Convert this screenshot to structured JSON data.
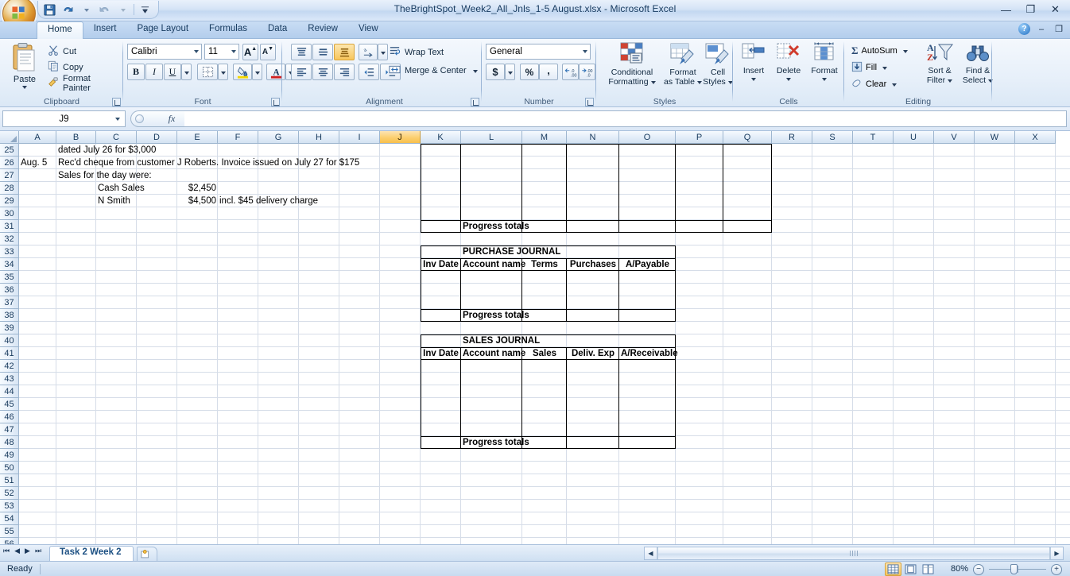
{
  "window": {
    "title": "TheBrightSpot_Week2_All_Jnls_1-5 August.xlsx  -  Microsoft Excel",
    "minimize": "—",
    "restore": "❐",
    "close": "✕"
  },
  "quick_access": {
    "save": "save-icon",
    "undo": "undo-icon",
    "redo": "redo-icon",
    "customize": "customize-icon"
  },
  "tabs": [
    {
      "label": "Home",
      "active": true
    },
    {
      "label": "Insert",
      "active": false
    },
    {
      "label": "Page Layout",
      "active": false
    },
    {
      "label": "Formulas",
      "active": false
    },
    {
      "label": "Data",
      "active": false
    },
    {
      "label": "Review",
      "active": false
    },
    {
      "label": "View",
      "active": false
    }
  ],
  "help": {
    "help_label": "?",
    "minimize_ribbon": "–",
    "restore_window": "❐"
  },
  "ribbon": {
    "clipboard": {
      "group_label": "Clipboard",
      "paste": "Paste",
      "cut": "Cut",
      "copy": "Copy",
      "format_painter": "Format Painter"
    },
    "font": {
      "group_label": "Font",
      "font_name": "Calibri",
      "font_size": "11",
      "grow_font": "A",
      "shrink_font": "A",
      "bold": "B",
      "italic": "I",
      "underline": "U",
      "borders": "borders-icon",
      "fill_color": "fill-color-icon",
      "font_color": "font-color-icon"
    },
    "alignment": {
      "group_label": "Alignment",
      "align_top": "align-top-icon",
      "align_middle": "align-middle-icon",
      "align_bottom": "align-bottom-icon",
      "orientation": "orientation-icon",
      "align_left": "align-left-icon",
      "align_center": "align-center-icon",
      "align_right": "align-right-icon",
      "decrease_indent": "decrease-indent-icon",
      "increase_indent": "increase-indent-icon",
      "wrap_text": "Wrap Text",
      "merge_center": "Merge & Center"
    },
    "number": {
      "group_label": "Number",
      "format": "General",
      "accounting": "$",
      "percent": "%",
      "comma": ",",
      "increase_decimal": "increase-decimal-icon",
      "decrease_decimal": "decrease-decimal-icon"
    },
    "styles": {
      "group_label": "Styles",
      "conditional_formatting": "Conditional\nFormatting",
      "conditional_formatting_l1": "Conditional",
      "conditional_formatting_l2": "Formatting",
      "format_as_table_l1": "Format",
      "format_as_table_l2": "as Table",
      "cell_styles_l1": "Cell",
      "cell_styles_l2": "Styles"
    },
    "cells": {
      "group_label": "Cells",
      "insert": "Insert",
      "delete": "Delete",
      "format": "Format"
    },
    "editing": {
      "group_label": "Editing",
      "autosum": "AutoSum",
      "fill": "Fill",
      "clear": "Clear",
      "sort_filter_l1": "Sort &",
      "sort_filter_l2": "Filter",
      "find_select_l1": "Find &",
      "find_select_l2": "Select"
    }
  },
  "formula_bar": {
    "name_box": "J9",
    "fx_label": "fx",
    "formula_value": "",
    "insert_function": "insert-function-icon"
  },
  "grid": {
    "columns": [
      "A",
      "B",
      "C",
      "D",
      "E",
      "F",
      "G",
      "H",
      "I",
      "J",
      "K",
      "L",
      "M",
      "N",
      "O",
      "P",
      "Q",
      "R",
      "S",
      "T",
      "U",
      "V",
      "W",
      "X"
    ],
    "selected_column": "J",
    "rows": [
      25,
      26,
      27,
      28,
      29,
      30,
      31,
      32,
      33,
      34,
      35,
      36,
      37,
      38,
      39,
      40,
      41,
      42,
      43,
      44,
      45,
      46,
      47,
      48,
      49,
      50,
      51,
      52,
      53,
      54,
      55,
      56
    ],
    "cells": [
      {
        "row": 25,
        "col": "B",
        "text": "dated July 26 for $3,000",
        "align": "left",
        "bold": false
      },
      {
        "row": 26,
        "col": "A",
        "text": "Aug. 5",
        "align": "left",
        "bold": false
      },
      {
        "row": 26,
        "col": "B",
        "text": "Rec'd cheque from customer J Roberts. Invoice issued on July 27 for $175",
        "align": "left",
        "bold": false
      },
      {
        "row": 27,
        "col": "B",
        "text": "Sales for the day were:",
        "align": "left",
        "bold": false
      },
      {
        "row": 28,
        "col": "C",
        "text": "Cash Sales",
        "align": "left",
        "bold": false
      },
      {
        "row": 28,
        "col": "E",
        "text": "$2,450",
        "align": "right",
        "bold": false
      },
      {
        "row": 29,
        "col": "C",
        "text": "N Smith",
        "align": "left",
        "bold": false
      },
      {
        "row": 29,
        "col": "E",
        "text": "$4,500",
        "align": "right",
        "bold": false
      },
      {
        "row": 29,
        "col": "F",
        "text": "incl. $45 delivery charge",
        "align": "left",
        "bold": false
      },
      {
        "row": 31,
        "col": "L",
        "text": "Progress totals",
        "align": "left",
        "bold": true
      },
      {
        "row": 33,
        "col": "L",
        "text": "PURCHASE JOURNAL",
        "align": "center",
        "bold": true
      },
      {
        "row": 34,
        "col": "K",
        "text": "Inv Date",
        "align": "center",
        "bold": true
      },
      {
        "row": 34,
        "col": "L",
        "text": "Account name",
        "align": "center",
        "bold": true
      },
      {
        "row": 34,
        "col": "M",
        "text": "Terms",
        "align": "center",
        "bold": true
      },
      {
        "row": 34,
        "col": "N",
        "text": "Purchases",
        "align": "center",
        "bold": true
      },
      {
        "row": 34,
        "col": "O",
        "text": "A/Payable",
        "align": "center",
        "bold": true
      },
      {
        "row": 38,
        "col": "L",
        "text": "Progress totals",
        "align": "left",
        "bold": true
      },
      {
        "row": 40,
        "col": "L",
        "text": "SALES JOURNAL",
        "align": "center",
        "bold": true
      },
      {
        "row": 41,
        "col": "K",
        "text": "Inv Date",
        "align": "center",
        "bold": true
      },
      {
        "row": 41,
        "col": "L",
        "text": "Account name",
        "align": "center",
        "bold": true
      },
      {
        "row": 41,
        "col": "M",
        "text": "Sales",
        "align": "center",
        "bold": true
      },
      {
        "row": 41,
        "col": "N",
        "text": "Deliv. Exp",
        "align": "center",
        "bold": true
      },
      {
        "row": 41,
        "col": "O",
        "text": "A/Receivable",
        "align": "center",
        "bold": true
      },
      {
        "row": 48,
        "col": "L",
        "text": "Progress totals",
        "align": "left",
        "bold": true
      }
    ],
    "journals": [
      {
        "name": "cash-journal-continuation",
        "title": "",
        "headers": [],
        "first_row": 25,
        "totals_row": 31,
        "totals_label": "Progress totals",
        "columns": [
          "K",
          "L",
          "M",
          "N",
          "O",
          "P",
          "Q"
        ]
      },
      {
        "name": "purchase-journal",
        "title": "PURCHASE JOURNAL",
        "headers": [
          "Inv Date",
          "Account name",
          "Terms",
          "Purchases",
          "A/Payable"
        ],
        "title_row": 33,
        "header_row": 34,
        "totals_row": 38,
        "totals_label": "Progress totals",
        "columns": [
          "K",
          "L",
          "M",
          "N",
          "O"
        ]
      },
      {
        "name": "sales-journal",
        "title": "SALES JOURNAL",
        "headers": [
          "Inv Date",
          "Account name",
          "Sales",
          "Deliv. Exp",
          "A/Receivable"
        ],
        "title_row": 40,
        "header_row": 41,
        "totals_row": 48,
        "totals_label": "Progress totals",
        "columns": [
          "K",
          "L",
          "M",
          "N",
          "O"
        ]
      }
    ]
  },
  "sheet_bar": {
    "first": "⏮",
    "prev": "◀",
    "next": "▶",
    "last": "⏭",
    "sheets": [
      {
        "label": "Task 2 Week 2",
        "active": true
      }
    ],
    "insert_sheet": "insert-sheet-icon",
    "scroll_left": "◀",
    "scroll_right": "▶"
  },
  "status_bar": {
    "status": "Ready",
    "view_normal": "normal-view-icon",
    "view_page_layout": "page-layout-view-icon",
    "view_page_break": "page-break-view-icon",
    "zoom_level": "80%",
    "zoom_out": "−",
    "zoom_in": "+"
  },
  "colors": {
    "accent": "#1b4f82",
    "selection": "#f7c65c",
    "grid_line": "#d6dde8",
    "header_text": "#17395c"
  }
}
